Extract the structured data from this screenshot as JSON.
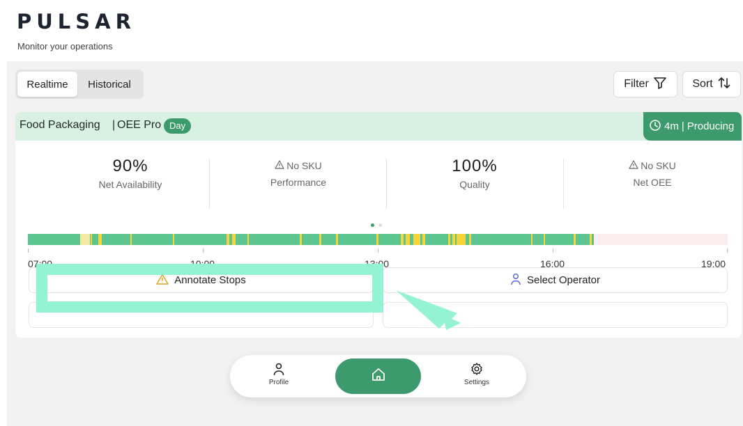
{
  "app": {
    "logo": "PULSAR",
    "tagline": "Monitor your operations"
  },
  "toolbar": {
    "tabs": [
      {
        "label": "Realtime",
        "active": true
      },
      {
        "label": "Historical",
        "active": false
      }
    ],
    "filter_label": "Filter",
    "sort_label": "Sort"
  },
  "line_card": {
    "name": "Food Packaging",
    "separator": "|",
    "product": "OEE Pro",
    "badge": "Day",
    "status": {
      "duration": "4m",
      "divider": "|",
      "state": "Producing"
    },
    "metrics": [
      {
        "value": "90%",
        "label": "Net Availability"
      },
      {
        "value": "No SKU",
        "label": "Performance"
      },
      {
        "value": "100%",
        "label": "Quality"
      },
      {
        "value": "No SKU",
        "label": "Net OEE"
      }
    ],
    "pager": {
      "pages": 2,
      "current": 1
    },
    "timeline": {
      "ticks": [
        "07:00",
        "10:00",
        "13:00",
        "16:00",
        "19:00"
      ],
      "colors": {
        "producing": "#5cc48f",
        "stopped": "#f5d33c",
        "idle_short": "#f6e9a3",
        "future": "#fbeeee"
      }
    },
    "actions": {
      "annotate_label": "Annotate Stops",
      "operator_label": "Select Operator"
    }
  },
  "bottom_nav": {
    "profile_label": "Profile",
    "settings_label": "Settings"
  },
  "colors": {
    "accent": "#3c9a6c",
    "header_band": "#d8f1e3",
    "highlight": "#93f3d2"
  }
}
